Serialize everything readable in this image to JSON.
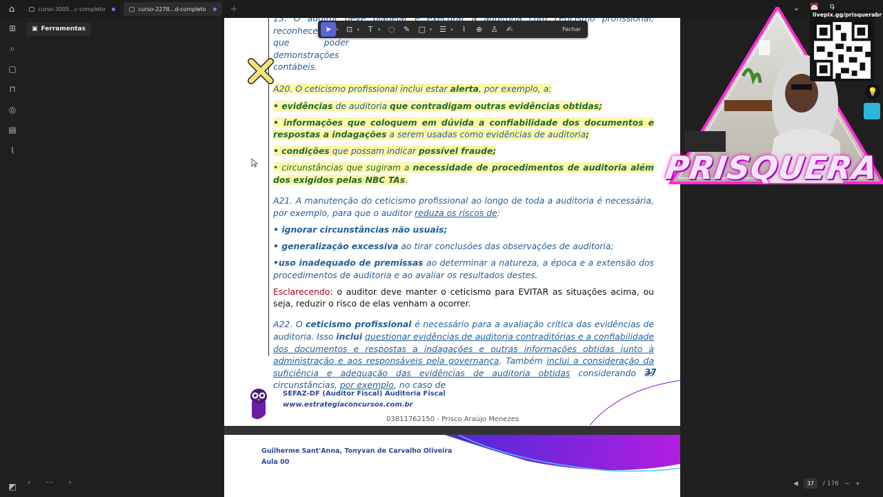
{
  "tabs": [
    {
      "label": "curso-3005...c-completo",
      "active": false
    },
    {
      "label": "curso-2278...d-completo",
      "active": true
    }
  ],
  "sidebar": {
    "tools_label": "Ferramentas"
  },
  "annotation_toolbar": {
    "close_label": "Fechar",
    "icons": [
      "select-icon",
      "area-select-icon",
      "text-icon",
      "comment-icon",
      "highlight-pen-icon",
      "shape-icon",
      "strikethrough-icon",
      "eraser-icon",
      "stamp-icon",
      "signature-person-icon",
      "signature-icon"
    ]
  },
  "document": {
    "top_cut": {
      "start": "que poder",
      "end": "demonstrações",
      "line2": "contábeis."
    },
    "a20": {
      "intro": "A20. O ceticismo profissional inclui estar ",
      "alerta": "alerta",
      "after": ", por exemplo, a:",
      "item1_a": "• evidências",
      "item1_b": " de auditoria ",
      "item1_c": "que contradigam outras evidências obtidas;",
      "item2_a": "• informações que coloquem em dúvida a confiabilidade dos documentos e respostas a indagações",
      "item2_b": " a serem usadas como evidências de auditoria",
      "item2_c": ";",
      "item3_a": "• condições",
      "item3_b": " que possam indicar ",
      "item3_c": "possível fraude;",
      "item4_a": "• circunstâncias que sugiram a ",
      "item4_b": "necessidade de procedimentos de auditoria além dos exigidos pelas NBC TAs",
      "item4_c": "."
    },
    "a21": {
      "intro": "A21. A manutenção do ceticismo profissional ao longo de toda a auditoria é necessária, por exemplo, para que o auditor ",
      "reduza": "reduza os riscos de",
      "colon": ":",
      "item1": "• ignorar circunstâncias não usuais;",
      "item2_a": "• generalização excessiva",
      "item2_b": " ao tirar conclusões das observações de auditoria;",
      "item3_a": "•uso inadequado de premissas",
      "item3_b": " ao determinar a natureza, a época e a extensão dos procedimentos de auditoria e ao avaliar os resultados destes."
    },
    "esclarecendo": {
      "label": "Esclarecendo",
      "text": ": o auditor deve manter o ceticismo para EVITAR as situações acima, ou seja, reduzir o risco de elas venham a ocorrer."
    },
    "a22": {
      "t1": "A22. O ",
      "t2": "ceticismo profissional",
      "t3": " é necessário para a avaliação crítica das evidências de auditoria. Isso ",
      "t4": "inclui",
      "t5": " ",
      "t6": "questionar evidências de auditoria contraditórias e a confiabilidade dos documentos e respostas a indagações e outras informações obtidas junto à administração e aos responsáveis pela governança",
      "t7": ". Também ",
      "t8": "inclui a consideração da suficiência e adequação das evidências de auditoria obtidas",
      "t9": " considerando as circunstâncias, ",
      "t10": "por exemplo",
      "t11": ", no caso de"
    },
    "page_number": "37",
    "footer_title": "SEFAZ-DF (Auditor Fiscal) Auditoria Fiscal",
    "footer_url": "www.estrategiaconcursos.com.br",
    "footer_id": "03811762150 - Prisco Araújo Menezes",
    "page2_authors": "Guilherme Sant'Anna, Tonyvan de Carvalho Oliveira",
    "page2_aula": "Aula 00"
  },
  "bottom_nav": {
    "page_current": "37",
    "page_total": "/ 176"
  },
  "overlay": {
    "livepix_url": "livepix.gg/prisquerabr",
    "brand": "PRISQUERA",
    "notification_count": "9"
  }
}
